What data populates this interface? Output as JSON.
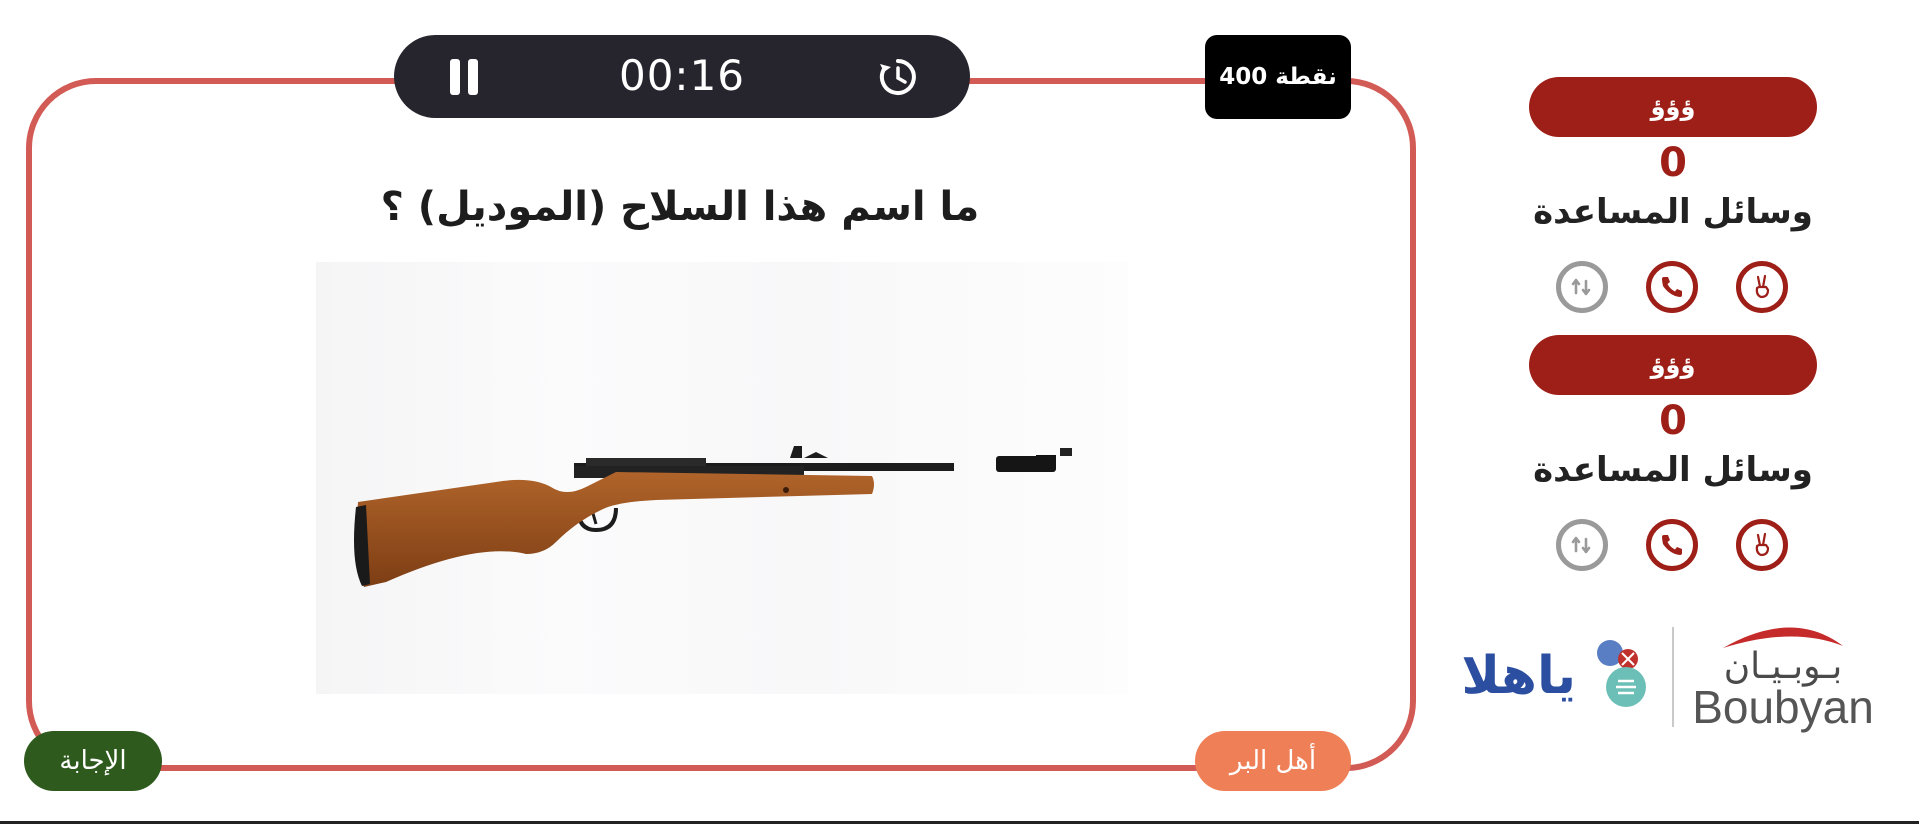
{
  "game": {
    "points": "400 نقطة",
    "timer": "00:16",
    "question": "ما اسم هذا السلاح (الموديل) ؟",
    "answer_button": "الإجابة",
    "team_turn": "أهل البر"
  },
  "teams": [
    {
      "name": "ؤؤؤ",
      "score": "0",
      "aids_label": "وسائل المساعدة"
    },
    {
      "name": "ؤؤؤ",
      "score": "0",
      "aids_label": "وسائل المساعدة"
    }
  ],
  "logos": {
    "yahala": "ياهلا",
    "boubyan_ar": "بـوبـيـان",
    "boubyan_en": "Boubyan"
  },
  "colors": {
    "frame": "#d35b56",
    "team_red": "#9e1f17",
    "answer_green": "#2e5a1e",
    "team_tag_orange": "#ee7f56",
    "timer_dark": "#26252e"
  }
}
